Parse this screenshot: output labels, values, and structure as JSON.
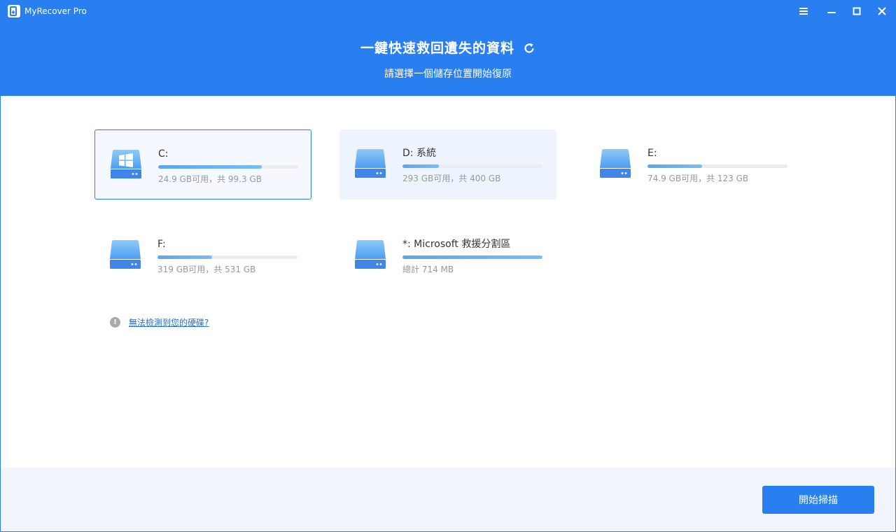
{
  "app": {
    "title": "MyRecover Pro"
  },
  "hero": {
    "title": "一鍵快速救回遺失的資料",
    "subtitle": "請選擇一個儲存位置開始復原"
  },
  "drives": [
    {
      "name": "C:",
      "info": "24.9 GB可用，共 99.3 GB",
      "used_fraction": 0.74,
      "state": "selected",
      "icon": "windows-drive-icon"
    },
    {
      "name": "D: 系統",
      "info": "293 GB可用，共 400 GB",
      "used_fraction": 0.26,
      "state": "hover",
      "icon": "drive-icon"
    },
    {
      "name": "E:",
      "info": "74.9 GB可用，共 123 GB",
      "used_fraction": 0.39,
      "state": "normal",
      "icon": "drive-icon"
    },
    {
      "name": "F:",
      "info": "319 GB可用，共 531 GB",
      "used_fraction": 0.39,
      "state": "normal",
      "icon": "drive-icon"
    },
    {
      "name": "*: Microsoft 救援分割區",
      "info": "總計 714 MB",
      "used_fraction": 1.0,
      "state": "normal",
      "icon": "drive-icon"
    }
  ],
  "help": {
    "link_text": "無法檢測到您的硬碟?"
  },
  "footer": {
    "scan_label": "開始掃描"
  },
  "colors": {
    "accent": "#2a7ff0",
    "bar_fill": "#5aa6ee",
    "bar_track": "#ececec",
    "footer_bg": "#f2f5fb"
  }
}
